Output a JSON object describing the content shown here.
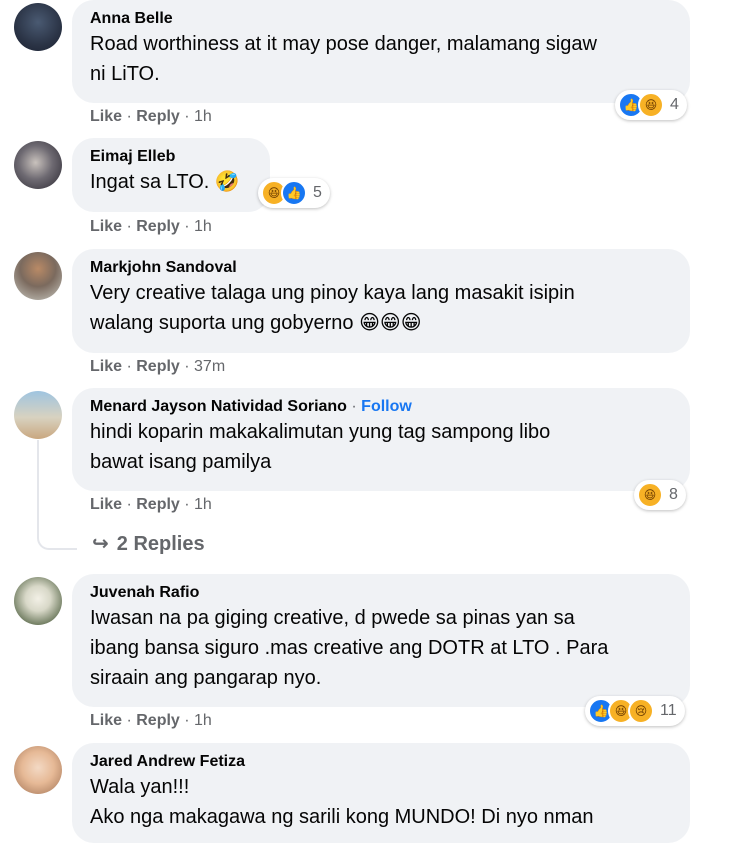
{
  "comments": [
    {
      "author": "Anna Belle",
      "lines": [
        "Road worthiness at it may pose danger, malamang sigaw",
        "ni LiTO."
      ],
      "like": "Like",
      "reply": "Reply",
      "time": "1h",
      "reaction_icons": [
        "like-icon",
        "haha-icon"
      ],
      "reaction_count": "4"
    },
    {
      "author": "Eimaj Elleb",
      "lines": [
        "Ingat sa LTO. 🤣"
      ],
      "like": "Like",
      "reply": "Reply",
      "time": "1h",
      "reaction_icons": [
        "haha-icon",
        "like-icon"
      ],
      "reaction_count": "5"
    },
    {
      "author": "Markjohn Sandoval",
      "lines": [
        "Very creative talaga ung pinoy kaya lang masakit isipin",
        "walang suporta ung gobyerno 😁😁😁"
      ],
      "like": "Like",
      "reply": "Reply",
      "time": "37m"
    },
    {
      "author": "Menard Jayson Natividad Soriano",
      "follow": "Follow",
      "lines": [
        "hindi koparin makakalimutan yung tag sampong libo",
        "bawat isang pamilya"
      ],
      "like": "Like",
      "reply": "Reply",
      "time": "1h",
      "reaction_icons": [
        "haha-icon"
      ],
      "reaction_count": "8",
      "replies_label": "2 Replies"
    },
    {
      "author": "Juvenah Rafio",
      "lines": [
        "Iwasan na pa giging creative, d pwede sa pinas yan sa",
        "ibang bansa siguro .mas creative ang DOTR at LTO . Para",
        "siraain ang pangarap nyo."
      ],
      "like": "Like",
      "reply": "Reply",
      "time": "1h",
      "reaction_icons": [
        "like-icon",
        "haha-icon",
        "sad-icon"
      ],
      "reaction_count": "11"
    },
    {
      "author": "Jared Andrew Fetiza",
      "lines": [
        "Wala yan!!!",
        "Ako nga makagawa ng sarili kong MUNDO! Di nyo nman"
      ]
    }
  ],
  "colors": {
    "bubble": "#f0f2f5",
    "link_blue": "#1877f2",
    "meta_gray": "#65676b",
    "haha_yellow": "#f7b125"
  }
}
